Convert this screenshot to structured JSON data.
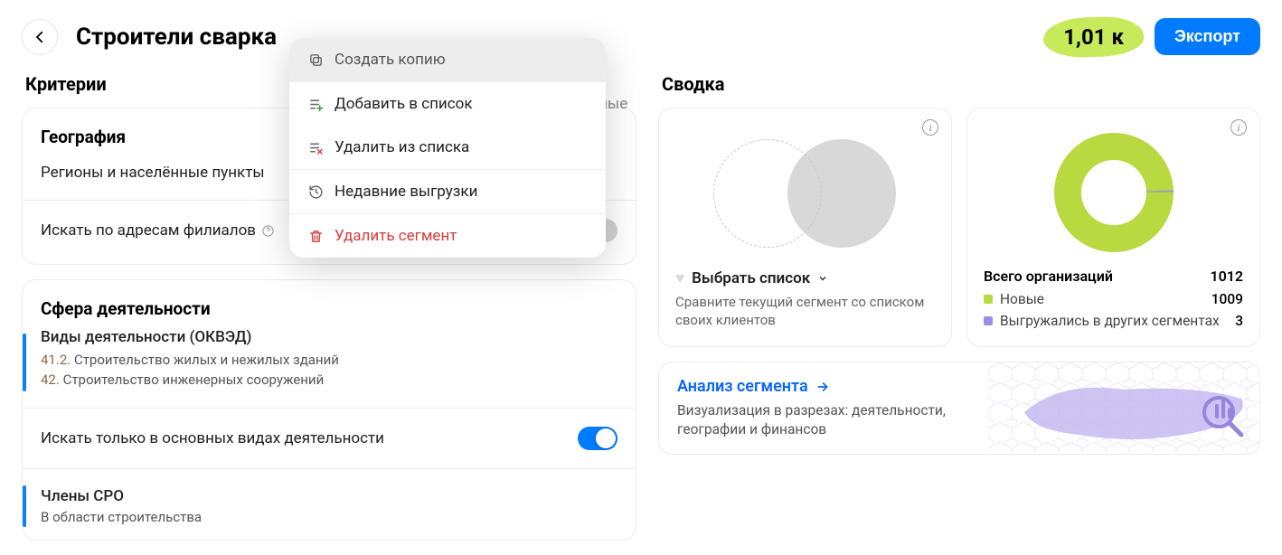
{
  "header": {
    "title": "Строители сварка",
    "count": "1,01 к",
    "export_label": "Экспорт"
  },
  "tab_partial": "менённые",
  "menu": {
    "copy": "Создать копию",
    "add_list": "Добавить в список",
    "remove_list": "Удалить из списка",
    "recent": "Недавние выгрузки",
    "delete": "Удалить сегмент"
  },
  "criteria_title": "Критерии",
  "geo": {
    "heading": "География",
    "regions_label": "Регионы и населённые пункты",
    "branches_label": "Искать по адресам филиалов"
  },
  "activity": {
    "heading": "Сфера деятельности",
    "okved_label": "Виды деятельности (ОКВЭД)",
    "okved_items": [
      {
        "code": "41.2.",
        "text": "Строительство жилых и нежилых зданий"
      },
      {
        "code": "42.",
        "text": "Строительство инженерных сооружений"
      }
    ],
    "main_only_label": "Искать только в основных видах деятельности",
    "sro_label": "Члены СРО",
    "sro_sub": "В области строительства"
  },
  "summary_title": "Сводка",
  "compare": {
    "select_label": "Выбрать список",
    "desc": "Сравните текущий сегмент со списком своих клиентов"
  },
  "stats": {
    "total_label": "Всего организаций",
    "total_value": "1012",
    "new_label": "Новые",
    "new_value": "1009",
    "exported_label": "Выгружались в других сегментах",
    "exported_value": "3",
    "colors": {
      "new": "#b8d93f",
      "exported": "#9b8fe0"
    }
  },
  "analysis": {
    "link": "Анализ сегмента",
    "desc": "Визуализация в разрезах: деятельности, географии и финансов"
  },
  "chart_data": {
    "type": "pie",
    "title": "Всего организаций",
    "series": [
      {
        "name": "Новые",
        "value": 1009,
        "color": "#b8d93f"
      },
      {
        "name": "Выгружались в других сегментах",
        "value": 3,
        "color": "#9b8fe0"
      }
    ],
    "total": 1012
  }
}
